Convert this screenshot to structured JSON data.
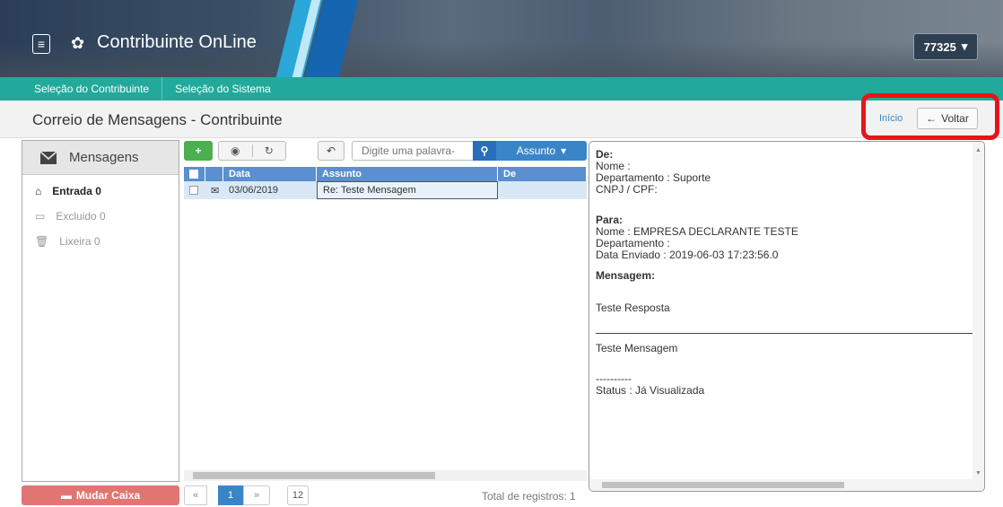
{
  "header": {
    "title": "Contribuinte OnLine",
    "user": "77325"
  },
  "nav": {
    "items": [
      "Seleção do Contribuinte",
      "Seleção do Sistema"
    ]
  },
  "page": {
    "title": "Correio de Mensagens - Contribuinte",
    "inicio": "Início",
    "voltar": "Voltar"
  },
  "left": {
    "header": "Mensagens",
    "folders": [
      {
        "label": "Entrada 0",
        "active": true
      },
      {
        "label": "Excluido 0",
        "active": false
      },
      {
        "label": "Lixeira 0",
        "active": false
      }
    ],
    "mudar_caixa": "Mudar Caixa"
  },
  "toolbar": {
    "search_placeholder": "Digite uma palavra-",
    "assunto": "Assunto"
  },
  "table": {
    "columns": [
      "Data",
      "Assunto",
      "De"
    ],
    "rows": [
      {
        "data": "03/06/2019",
        "assunto": "Re: Teste Mensagem",
        "de": ""
      }
    ]
  },
  "pager": {
    "first": "«",
    "current": "1",
    "next": "»",
    "page_size": "12",
    "total": "Total de registros: 1"
  },
  "message": {
    "de_label": "De:",
    "de_nome": "Nome :",
    "de_departamento": "Departamento : Suporte",
    "de_cnpj": "CNPJ / CPF:",
    "para_label": "Para:",
    "para_nome": "Nome : EMPRESA DECLARANTE TESTE",
    "para_departamento": "Departamento :",
    "data_enviado": "Data Enviado : 2019-06-03 17:23:56.0",
    "mensagem_label": "Mensagem:",
    "resposta": "Teste Resposta",
    "original": "Teste Mensagem",
    "separator": "----------",
    "status": "Status : Já Visualizada"
  },
  "colors": {
    "nav": "#22a99c",
    "accent": "#3a85c8",
    "new_button": "#4caf50",
    "mudar_button": "#d9534f",
    "highlight": "#e8141b"
  }
}
